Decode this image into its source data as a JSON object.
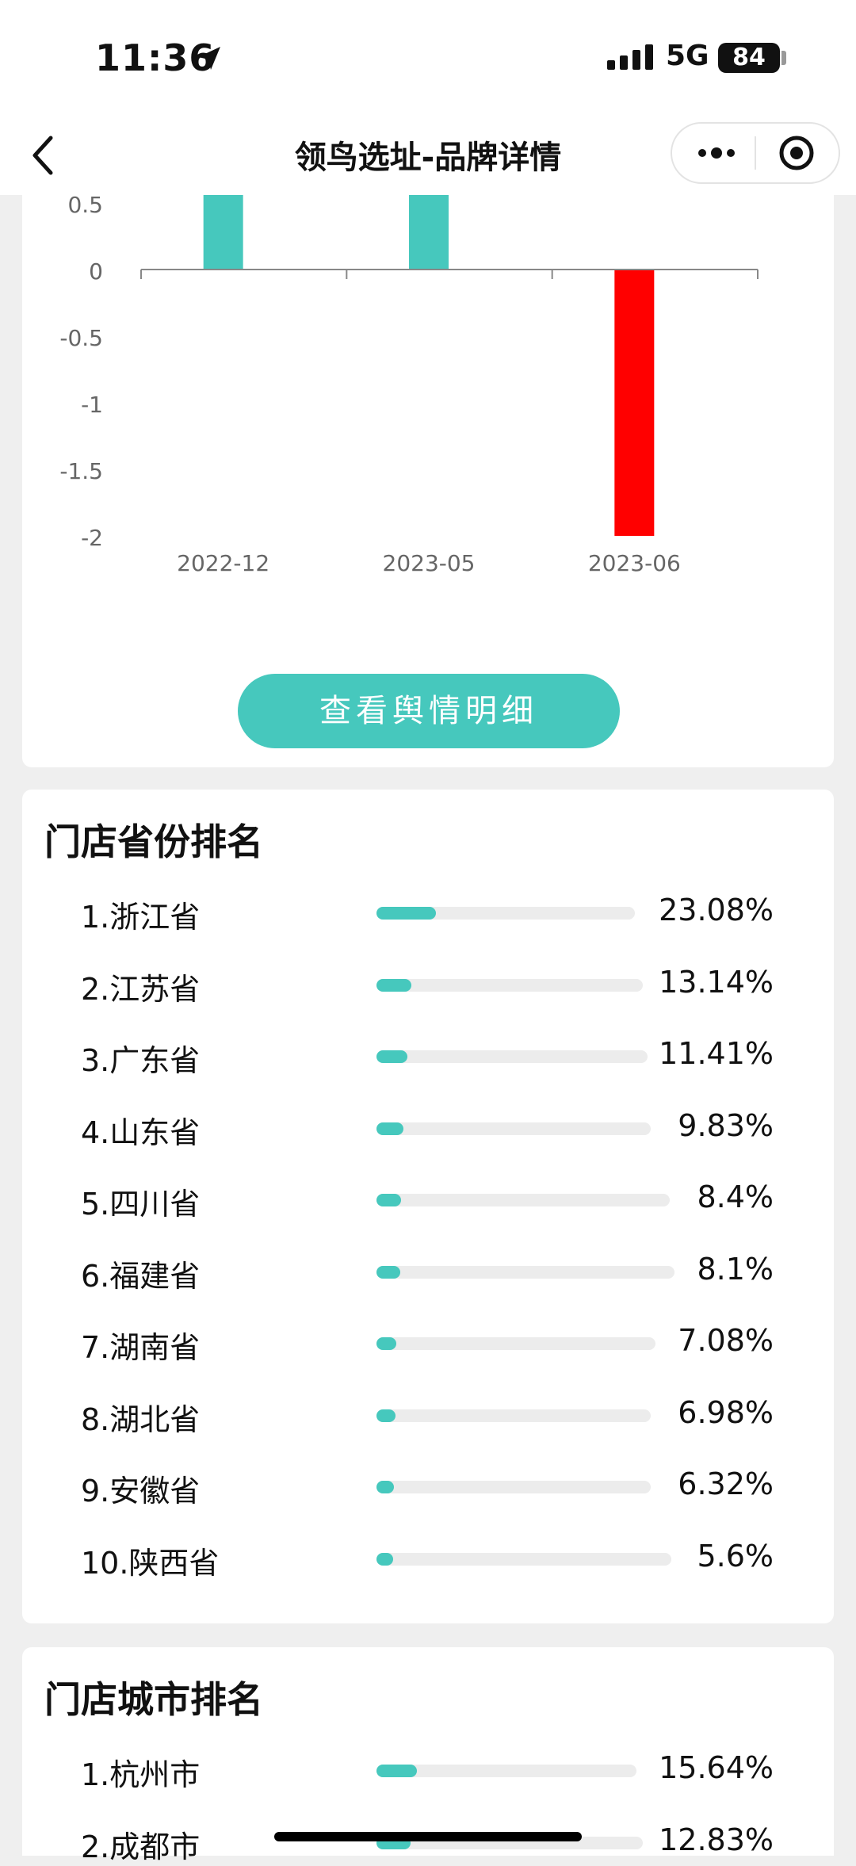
{
  "status_bar": {
    "time": "11:36",
    "network": "5G",
    "battery": "84"
  },
  "nav": {
    "title": "领鸟选址-品牌详情"
  },
  "colors": {
    "accent": "#46c8bd",
    "negative": "#ff0000"
  },
  "chart_data": {
    "type": "bar",
    "categories": [
      "2022-12",
      "2023-05",
      "2023-06"
    ],
    "values": [
      1,
      1,
      -2
    ],
    "y_ticks": [
      "0.5",
      "0",
      "-0.5",
      "-1",
      "-1.5",
      "-2"
    ],
    "visible_ylim": [
      -2,
      0.5
    ],
    "bar_colors": [
      "#46c8bd",
      "#46c8bd",
      "#ff0000"
    ],
    "note_visible_top": "chart is scrolled; bars for 2022-12 and 2023-05 extend above visible area"
  },
  "sentiment_button": "查看舆情明细",
  "province_ranking": {
    "title": "门店省份排名",
    "items": [
      {
        "label": "1.浙江省",
        "pct": "23.08%",
        "value": 23.08
      },
      {
        "label": "2.江苏省",
        "pct": "13.14%",
        "value": 13.14
      },
      {
        "label": "3.广东省",
        "pct": "11.41%",
        "value": 11.41
      },
      {
        "label": "4.山东省",
        "pct": "9.83%",
        "value": 9.83
      },
      {
        "label": "5.四川省",
        "pct": "8.4%",
        "value": 8.4
      },
      {
        "label": "6.福建省",
        "pct": "8.1%",
        "value": 8.1
      },
      {
        "label": "7.湖南省",
        "pct": "7.08%",
        "value": 7.08
      },
      {
        "label": "8.湖北省",
        "pct": "6.98%",
        "value": 6.98
      },
      {
        "label": "9.安徽省",
        "pct": "6.32%",
        "value": 6.32
      },
      {
        "label": "10.陕西省",
        "pct": "5.6%",
        "value": 5.6
      }
    ]
  },
  "city_ranking": {
    "title": "门店城市排名",
    "items": [
      {
        "label": "1.杭州市",
        "pct": "15.64%",
        "value": 15.64
      },
      {
        "label": "2.成都市",
        "pct": "12.83%",
        "value": 12.83
      }
    ]
  }
}
